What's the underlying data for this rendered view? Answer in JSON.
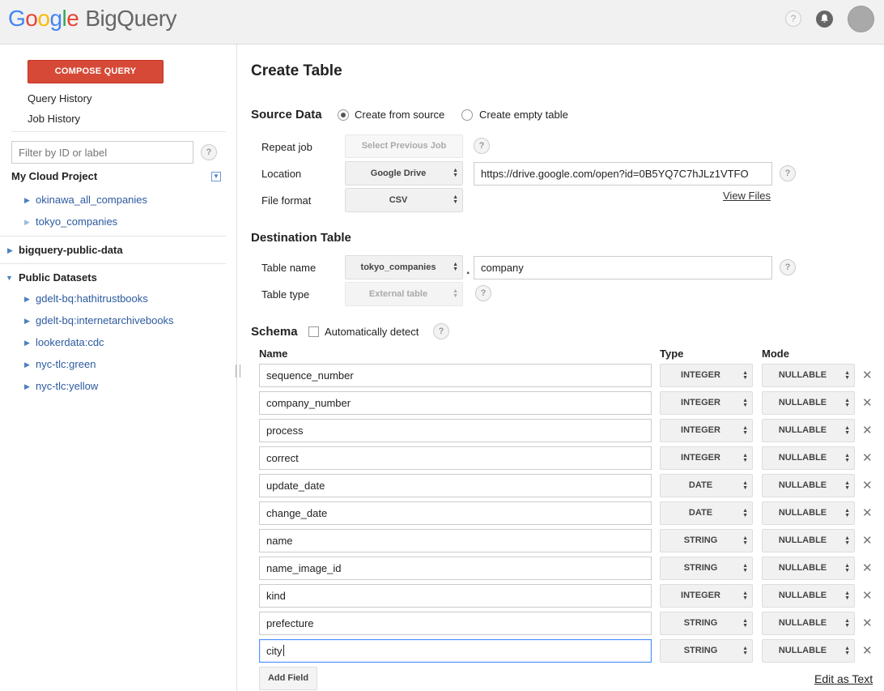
{
  "header": {
    "logo_google": [
      "G",
      "o",
      "o",
      "g",
      "l",
      "e"
    ],
    "logo_product": "BigQuery",
    "help_icon": "?",
    "notifications_icon": "bell-icon",
    "avatar": "avatar"
  },
  "sidebar": {
    "compose_label": "COMPOSE QUERY",
    "query_history": "Query History",
    "job_history": "Job History",
    "filter_placeholder": "Filter by ID or label",
    "help": "?",
    "project_title": "My Cloud Project",
    "project_datasets": [
      "okinawa_all_companies",
      "tokyo_companies"
    ],
    "public_data_title": "bigquery-public-data",
    "public_datasets_title": "Public Datasets",
    "public_datasets": [
      "gdelt-bq:hathitrustbooks",
      "gdelt-bq:internetarchivebooks",
      "lookerdata:cdc",
      "nyc-tlc:green",
      "nyc-tlc:yellow"
    ]
  },
  "main": {
    "title": "Create Table",
    "source": {
      "label": "Source Data",
      "option_from_source": "Create from source",
      "option_empty": "Create empty table",
      "repeat_job_label": "Repeat job",
      "repeat_job_button": "Select Previous Job",
      "location_label": "Location",
      "location_value": "Google Drive",
      "location_url": "https://drive.google.com/open?id=0B5YQ7C7hJLz1VTFO",
      "view_files": "View Files",
      "format_label": "File format",
      "format_value": "CSV"
    },
    "destination": {
      "label": "Destination Table",
      "table_name_label": "Table name",
      "dataset_value": "tokyo_companies",
      "separator": ".",
      "table_name_value": "company",
      "table_type_label": "Table type",
      "table_type_value": "External table"
    },
    "schema": {
      "label": "Schema",
      "auto_detect": "Automatically detect",
      "col_name": "Name",
      "col_type": "Type",
      "col_mode": "Mode",
      "fields": [
        {
          "name": "sequence_number",
          "type": "INTEGER",
          "mode": "NULLABLE"
        },
        {
          "name": "company_number",
          "type": "INTEGER",
          "mode": "NULLABLE"
        },
        {
          "name": "process",
          "type": "INTEGER",
          "mode": "NULLABLE"
        },
        {
          "name": "correct",
          "type": "INTEGER",
          "mode": "NULLABLE"
        },
        {
          "name": "update_date",
          "type": "DATE",
          "mode": "NULLABLE"
        },
        {
          "name": "change_date",
          "type": "DATE",
          "mode": "NULLABLE"
        },
        {
          "name": "name",
          "type": "STRING",
          "mode": "NULLABLE"
        },
        {
          "name": "name_image_id",
          "type": "STRING",
          "mode": "NULLABLE"
        },
        {
          "name": "kind",
          "type": "INTEGER",
          "mode": "NULLABLE"
        },
        {
          "name": "prefecture",
          "type": "STRING",
          "mode": "NULLABLE"
        },
        {
          "name": "city",
          "type": "STRING",
          "mode": "NULLABLE"
        }
      ],
      "delete_glyph": "✕",
      "add_field": "Add Field",
      "edit_as_text": "Edit as Text"
    }
  }
}
